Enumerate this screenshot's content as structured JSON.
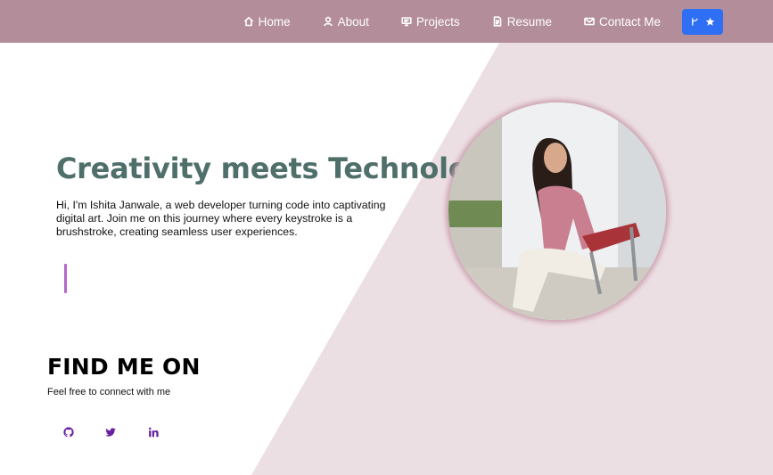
{
  "nav": {
    "items": [
      {
        "label": "Home",
        "icon": "home-icon"
      },
      {
        "label": "About",
        "icon": "user-icon"
      },
      {
        "label": "Projects",
        "icon": "monitor-icon"
      },
      {
        "label": "Resume",
        "icon": "document-icon"
      },
      {
        "label": "Contact Me",
        "icon": "envelope-icon"
      }
    ],
    "fork_button": {
      "icons": [
        "fork-icon",
        "star-icon"
      ]
    }
  },
  "hero": {
    "title": "Creativity meets Technology",
    "description": "Hi, I'm Ishita Janwale, a web developer turning code into captivating digital art. Join me on this journey where every keystroke is a brushstroke, creating seamless user experiences."
  },
  "portrait": {
    "icon": "profile-photo"
  },
  "find_me": {
    "title": "FIND ME ON",
    "subtitle": "Feel free to connect with me",
    "links": [
      {
        "icon": "github-icon"
      },
      {
        "icon": "twitter-icon"
      },
      {
        "icon": "linkedin-icon"
      }
    ]
  },
  "colors": {
    "navbar": "#b38e9a",
    "diagonal_panel": "#ecdfe3",
    "title_text": "#4f6f6a",
    "accent_button": "#2f6ff3",
    "cursor_bar": "#b469c9",
    "social_icons": "#6a1fa0"
  }
}
